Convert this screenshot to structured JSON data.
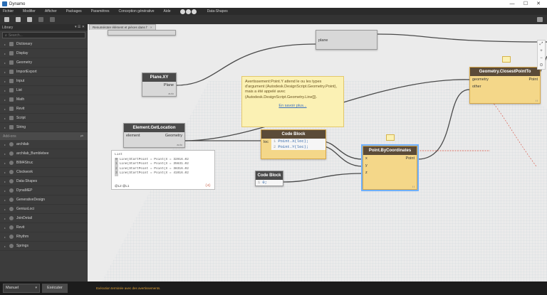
{
  "window": {
    "title": "Dynamo",
    "controls": [
      "—",
      "☐",
      "✕"
    ]
  },
  "menu": [
    "Fichier",
    "Modifier",
    "Afficher",
    "Packages",
    "Paramètres",
    "Conception générative",
    "Aide",
    "Data-Shapes"
  ],
  "library": {
    "title": "Library",
    "search_placeholder": "Search...",
    "items": [
      "Dictionary",
      "Display",
      "Geometry",
      "ImportExport",
      "Input",
      "List",
      "Math",
      "Revit",
      "Script",
      "String"
    ],
    "addons_label": "Add-ons",
    "packages": [
      "archilab",
      "archilab_Bumblebee",
      "BIM4Struc",
      "Clockwork",
      "Data-Shapes",
      "DynaMEP",
      "GenerativeDesign",
      "GeniusLoci",
      "JoinDetail",
      "Revit",
      "Rhythm",
      "Springs"
    ]
  },
  "workspace": {
    "tab_label": "Renuméroter élément et pièces dans l'",
    "tab_close": "×",
    "nodes": {
      "top_partial": {
        "port": "plane"
      },
      "plane_xy": {
        "title": "Plane.XY",
        "out": "Plane",
        "lacing": "auto"
      },
      "element_getlocation": {
        "title": "Element.GetLocation",
        "in": "element",
        "out": "Geometry",
        "lacing": "auto"
      },
      "code_block_main": {
        "title": "Code Block",
        "in": "loc",
        "line1_num": "1",
        "line1": "Point.X(loc);",
        "line2_num": "2",
        "line2": "Point.Y(loc);"
      },
      "code_block_zero": {
        "title": "Code Block",
        "line_num": "1",
        "line": "0;"
      },
      "point_bycoordinates": {
        "title": "Point.ByCoordinates",
        "in_x": "x",
        "in_y": "y",
        "in_z": "z",
        "out": "Point",
        "lacing": "l l"
      },
      "geometry_closestpoint": {
        "title": "Geometry.ClosestPointTo",
        "in_geometry": "geometry",
        "in_other": "other",
        "out": "Point",
        "lacing": "l l"
      }
    },
    "warning": {
      "text": "Avertissement:Point.Y attend le ou les types d'argument (Autodesk.DesignScript.Geometry.Point), mais a été appelé avec (Autodesk.DesignScript.Geometry.Line[]).",
      "link": "En savoir plus..."
    },
    "preview": {
      "header": "List",
      "rows": [
        {
          "idx": "0",
          "text": "Line(StartPoint = Point(X = 32916.02"
        },
        {
          "idx": "1",
          "text": "Line(StartPoint = Point(X = 35631.02"
        },
        {
          "idx": "2",
          "text": "Line(StartPoint = Point(X = 38316.02"
        },
        {
          "idx": "3",
          "text": "Line(StartPoint = Point(X = 41016.02"
        }
      ],
      "footer": "@L2 @L1",
      "count": "{4}"
    },
    "zoom": [
      "⤢",
      "+",
      "−",
      "⊙"
    ]
  },
  "status": {
    "run_mode": "Manuel",
    "run_button": "Exécuter",
    "message": "Exécution terminée avec des avertissements."
  },
  "colors": {
    "warning_node": "#f4d789",
    "node_header": "#4a4a4a",
    "wire": "#4a4a4a",
    "status_warning": "#e0a33a"
  }
}
